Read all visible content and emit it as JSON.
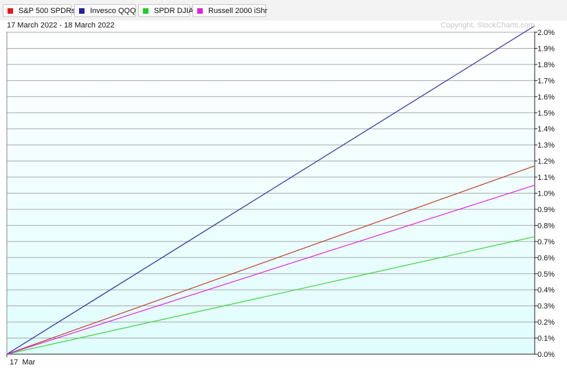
{
  "legend": [
    {
      "label": "S&P 500 SPDRs",
      "color": "#e31a1c"
    },
    {
      "label": "Invesco QQQ",
      "color": "#1f1fa8"
    },
    {
      "label": "SPDR DJIA",
      "color": "#22cc22"
    },
    {
      "label": "Russell 2000 iShr",
      "color": "#e020e0"
    }
  ],
  "header": {
    "date_range": "17 March 2022 - 18 March 2022",
    "copyright": "Copyright, StockCharts.com"
  },
  "chart_data": {
    "type": "line",
    "x": [
      "17 Mar",
      "18 Mar"
    ],
    "x_tick_labels": [
      "17  Mar"
    ],
    "ylim": [
      0.0,
      2.0
    ],
    "y_tick_labels": [
      "0.0%",
      "0.1%",
      "0.2%",
      "0.3%",
      "0.4%",
      "0.5%",
      "0.6%",
      "0.7%",
      "0.8%",
      "0.9%",
      "1.0%",
      "1.1%",
      "1.2%",
      "1.3%",
      "1.4%",
      "1.5%",
      "1.6%",
      "1.7%",
      "1.8%",
      "1.9%",
      "2.0%"
    ],
    "y_axis_side": "right",
    "grid": true,
    "series": [
      {
        "name": "S&P 500 SPDRs",
        "color": "#c0392b",
        "values": [
          0.0,
          1.17
        ]
      },
      {
        "name": "Invesco QQQ",
        "color": "#2b2b9f",
        "values": [
          0.0,
          2.04
        ]
      },
      {
        "name": "SPDR DJIA",
        "color": "#3bd43b",
        "values": [
          0.0,
          0.73
        ]
      },
      {
        "name": "Russell 2000 iShr",
        "color": "#e020e0",
        "values": [
          0.0,
          1.05
        ]
      }
    ]
  }
}
